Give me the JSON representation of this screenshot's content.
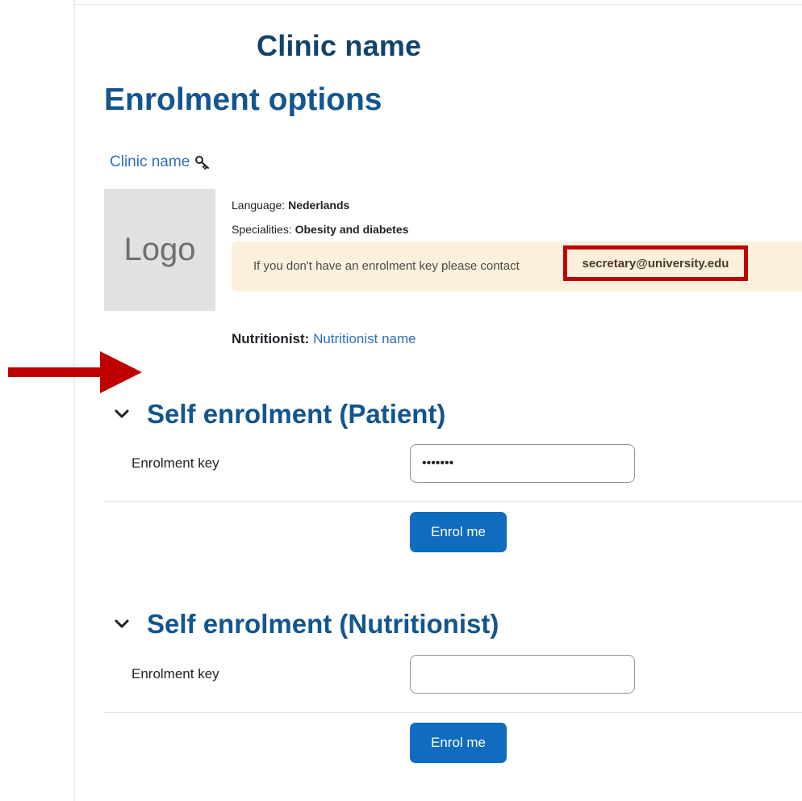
{
  "header": {
    "clinic_title": "Clinic name"
  },
  "page": {
    "title": "Enrolment options"
  },
  "course": {
    "link_label": "Clinic name",
    "logo_text": "Logo",
    "language_label": "Language:",
    "language_value": "Nederlands",
    "specialities_label": "Specialities:",
    "specialities_value": "Obesity and diabetes",
    "notice_text": "If you don't have an enrolment key please contact",
    "notice_email": "secretary@university.edu",
    "nutritionist_label": "Nutritionist:",
    "nutritionist_name": "Nutritionist name"
  },
  "sections": [
    {
      "title": "Self enrolment (Patient)",
      "key_label": "Enrolment key",
      "key_value": "•••••••",
      "button_label": "Enrol me"
    },
    {
      "title": "Self enrolment (Nutritionist)",
      "key_label": "Enrolment key",
      "key_value": "",
      "button_label": "Enrol me"
    }
  ],
  "colors": {
    "heading": "#12558f",
    "link": "#2f6ebc",
    "button": "#0f6cbf",
    "alert_bg": "#fcefdc",
    "highlight": "#c00000",
    "arrow": "#c00000"
  },
  "icons": {
    "course_key": "key-icon",
    "section_toggle": "chevron-down-icon",
    "annotation": "arrow-right-icon"
  }
}
